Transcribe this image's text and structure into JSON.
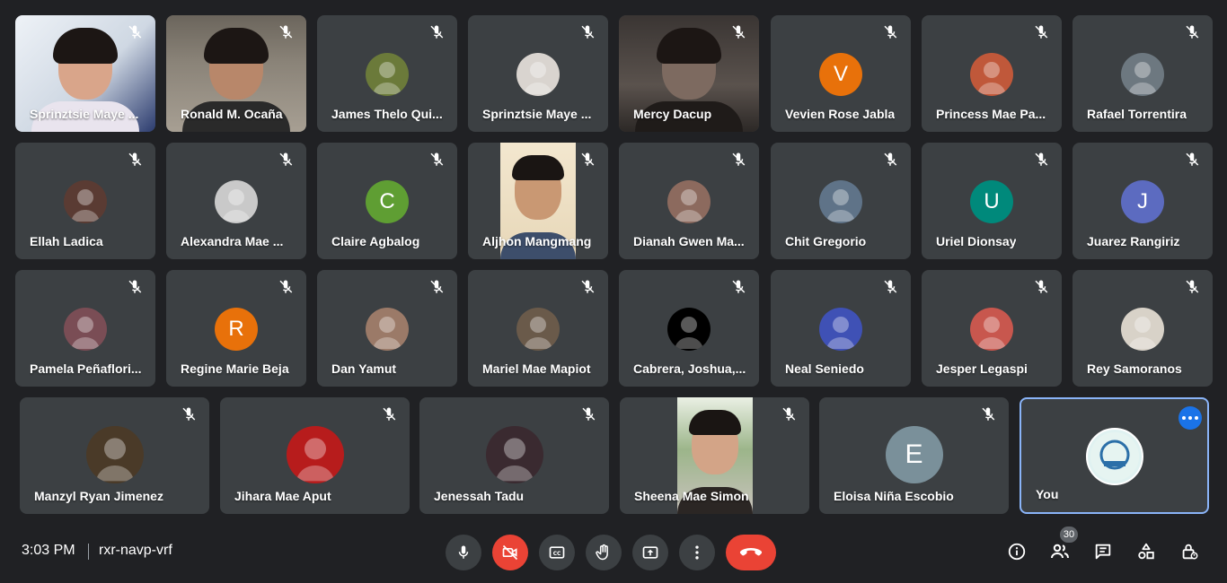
{
  "participants": [
    {
      "name": "Sprinztsie Maye ...",
      "avatar": "",
      "avatar_color": "",
      "kind": "video-photo"
    },
    {
      "name": "Ronald M. Ocaña",
      "avatar": "",
      "avatar_color": "",
      "kind": "video-photo"
    },
    {
      "name": "James Thelo Qui...",
      "avatar": "",
      "avatar_color": "#6b7a3a",
      "kind": "photo"
    },
    {
      "name": "Sprinztsie Maye ...",
      "avatar": "",
      "avatar_color": "#d9d4cf",
      "kind": "photo"
    },
    {
      "name": "Mercy Dacup",
      "avatar": "",
      "avatar_color": "",
      "kind": "video-photo"
    },
    {
      "name": "Vevien Rose Jabla",
      "avatar": "V",
      "avatar_color": "#e8710a",
      "kind": "letter"
    },
    {
      "name": "Princess Mae Pa...",
      "avatar": "",
      "avatar_color": "#c0583a",
      "kind": "photo"
    },
    {
      "name": "Rafael Torrentira",
      "avatar": "",
      "avatar_color": "#6d7880",
      "kind": "photo"
    },
    {
      "name": "Ellah Ladica",
      "avatar": "",
      "avatar_color": "#5a3b33",
      "kind": "photo"
    },
    {
      "name": "Alexandra Mae ...",
      "avatar": "",
      "avatar_color": "#c9c9c9",
      "kind": "photo"
    },
    {
      "name": "Claire Agbalog",
      "avatar": "C",
      "avatar_color": "#5f9e33",
      "kind": "letter"
    },
    {
      "name": "Aljhon Mangmang",
      "avatar": "",
      "avatar_color": "",
      "kind": "video-person"
    },
    {
      "name": "Dianah Gwen Ma...",
      "avatar": "",
      "avatar_color": "#8c6a5e",
      "kind": "photo"
    },
    {
      "name": "Chit Gregorio",
      "avatar": "",
      "avatar_color": "#5f7388",
      "kind": "photo"
    },
    {
      "name": "Uriel Dionsay",
      "avatar": "U",
      "avatar_color": "#00897b",
      "kind": "letter"
    },
    {
      "name": "Juarez Rangiriz",
      "avatar": "J",
      "avatar_color": "#5c6bc0",
      "kind": "letter"
    },
    {
      "name": "Pamela Peñaflori...",
      "avatar": "",
      "avatar_color": "#7a4d55",
      "kind": "photo"
    },
    {
      "name": "Regine Marie Beja",
      "avatar": "R",
      "avatar_color": "#e8710a",
      "kind": "letter"
    },
    {
      "name": "Dan Yamut",
      "avatar": "",
      "avatar_color": "#9b7a68",
      "kind": "photo"
    },
    {
      "name": "Mariel Mae Mapiot",
      "avatar": "",
      "avatar_color": "#6a5a4a",
      "kind": "photo"
    },
    {
      "name": "Cabrera, Joshua,...",
      "avatar": "",
      "avatar_color": "#000000",
      "kind": "photo"
    },
    {
      "name": "Neal Seniedo",
      "avatar": "",
      "avatar_color": "#3f51b5",
      "kind": "photo"
    },
    {
      "name": "Jesper Legaspi",
      "avatar": "",
      "avatar_color": "#c8574e",
      "kind": "photo"
    },
    {
      "name": "Rey Samoranos",
      "avatar": "",
      "avatar_color": "#d8d2c8",
      "kind": "photo"
    },
    {
      "name": "Manzyl Ryan Jimenez",
      "avatar": "",
      "avatar_color": "#4a3a28",
      "kind": "photo-big"
    },
    {
      "name": "Jihara Mae Aput",
      "avatar": "",
      "avatar_color": "#b71c1c",
      "kind": "photo-big"
    },
    {
      "name": "Jenessah Tadu",
      "avatar": "",
      "avatar_color": "#3a2a30",
      "kind": "photo-big"
    },
    {
      "name": "Sheena Mae Simon",
      "avatar": "",
      "avatar_color": "",
      "kind": "video-person"
    },
    {
      "name": "Eloisa Niña Escobio",
      "avatar": "E",
      "avatar_color": "#7a909a",
      "kind": "letter-big"
    },
    {
      "name": "You",
      "avatar": "",
      "avatar_color": "#e0f2f1",
      "kind": "photo-big"
    }
  ],
  "bottom_bar": {
    "time": "3:03 PM",
    "meeting_code": "rxr-navp-vrf",
    "people_count": "30"
  },
  "colors": {
    "background": "#202124",
    "tile": "#3c4043",
    "hangup": "#ea4335",
    "active_border": "#8ab4f8"
  }
}
